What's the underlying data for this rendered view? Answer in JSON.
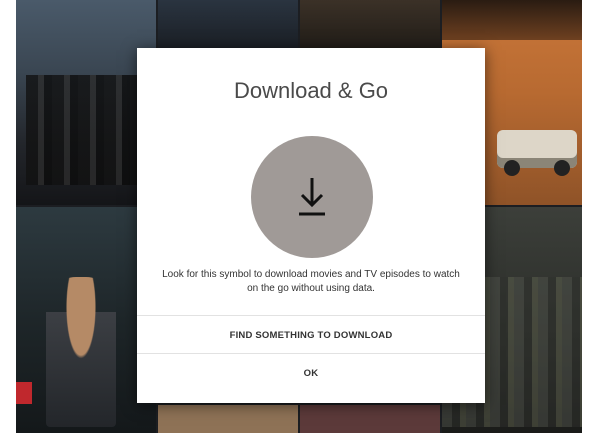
{
  "dialog": {
    "title": "Download & Go",
    "icon": "download-icon",
    "description": "Look for this symbol to download movies and TV episodes to watch on the go without using data.",
    "primary_action": "FIND SOMETHING TO DOWNLOAD",
    "secondary_action": "OK"
  },
  "colors": {
    "icon_circle": "#a09a97",
    "title_text": "#4a4a4a",
    "backdrop": "#1c1e22"
  }
}
